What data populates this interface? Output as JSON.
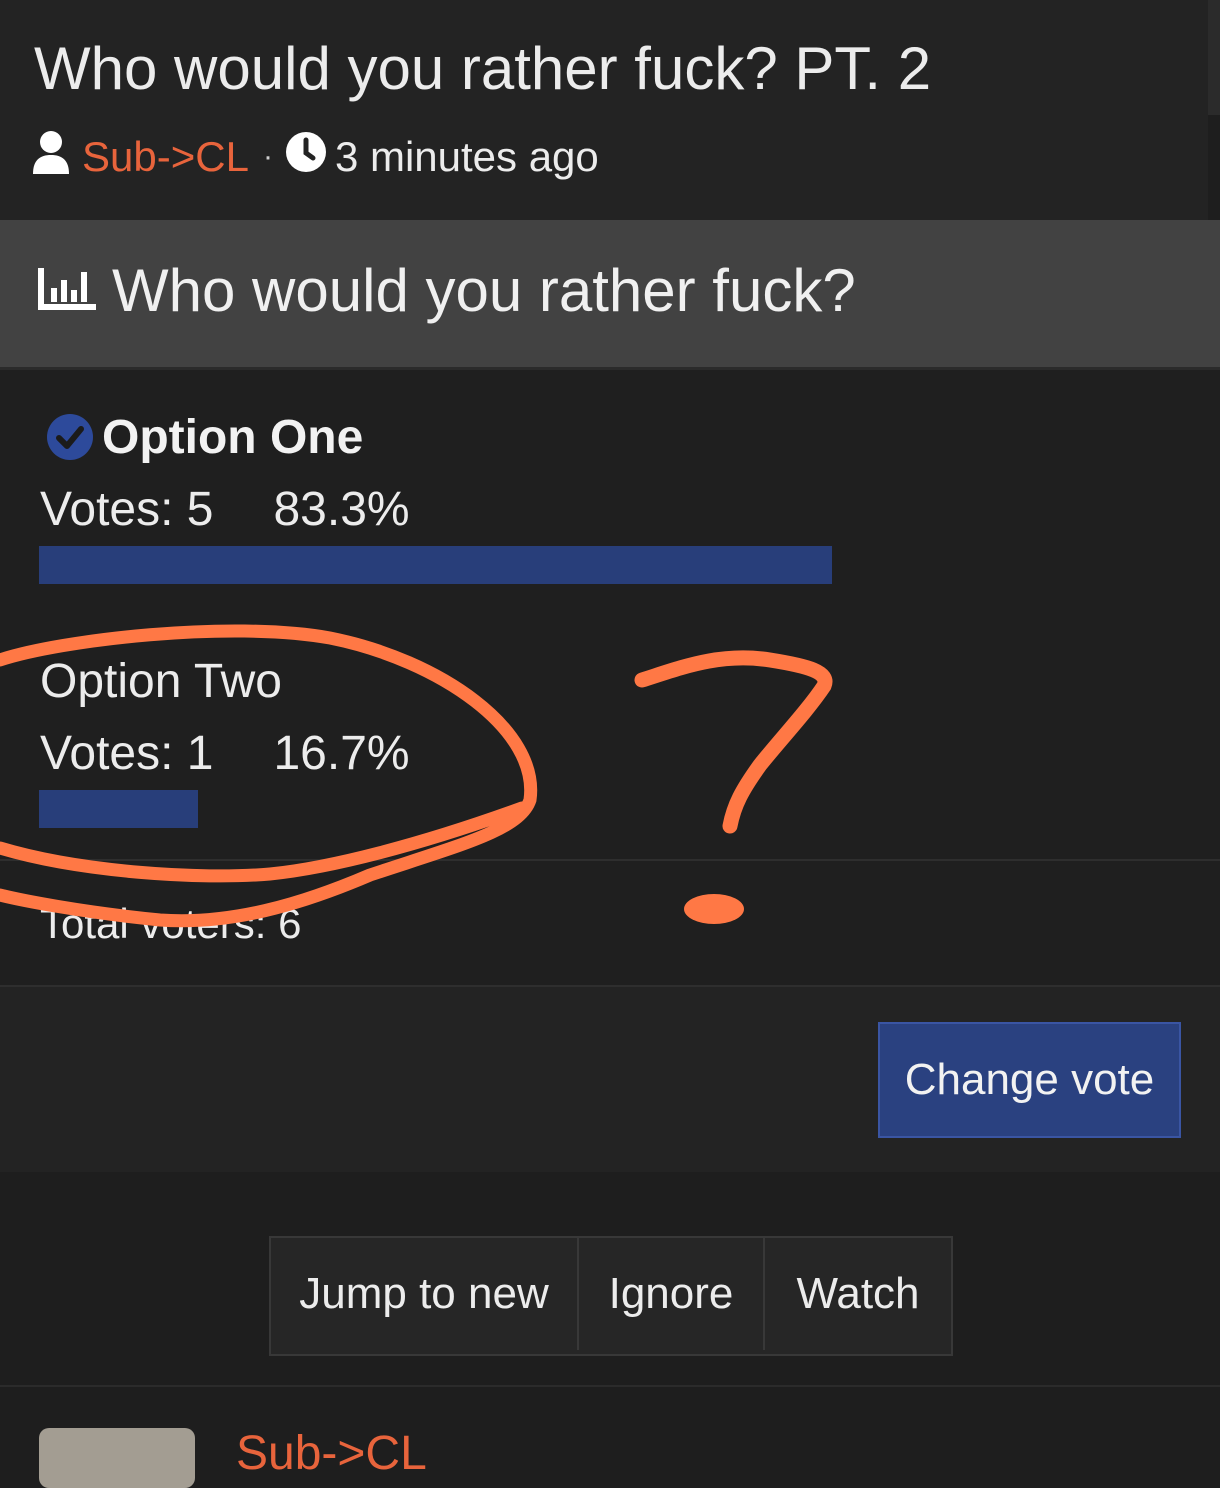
{
  "thread": {
    "title": "Who would you rather fuck? PT. 2",
    "author": "Sub->CL",
    "separator": "·",
    "time": "3 minutes ago"
  },
  "poll": {
    "question": "Who would you rather fuck?",
    "options": [
      {
        "label": "Option One",
        "votes_text": "Votes: 5",
        "percent_text": "83.3%",
        "votes": 5,
        "percent": 83.3,
        "voted": true
      },
      {
        "label": "Option Two",
        "votes_text": "Votes: 1",
        "percent_text": "16.7%",
        "votes": 1,
        "percent": 16.7,
        "voted": false
      }
    ],
    "total_voters": "Total voters: 6",
    "change_vote_label": "Change vote"
  },
  "thread_actions": {
    "jump_label": "Jump to new",
    "ignore_label": "Ignore",
    "watch_label": "Watch"
  },
  "next_post": {
    "author": "Sub->CL"
  },
  "colors": {
    "accent_orange": "#e8643c",
    "bar_blue": "#283e7a",
    "annotation": "#ff7845"
  },
  "icons": {
    "author": "user-icon",
    "time": "clock-icon",
    "poll": "bar-chart-icon",
    "voted": "check-circle-icon"
  }
}
